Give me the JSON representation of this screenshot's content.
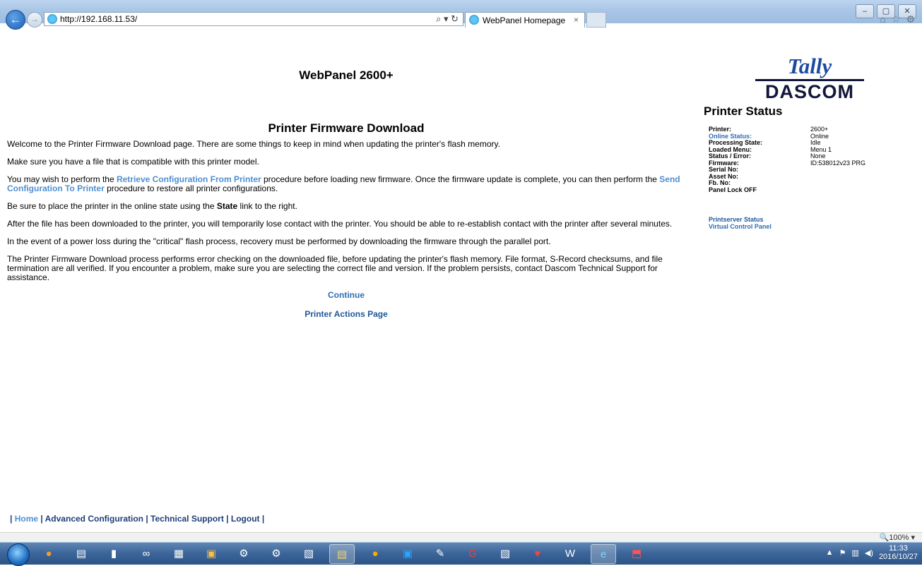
{
  "browser": {
    "title_text": "",
    "url": "http://192.168.11.53/",
    "search_glyph": "⌕ ▾ ↻",
    "tab_label": "WebPanel Homepage",
    "tab_close": "×",
    "window_controls": {
      "minimize": "–",
      "maximize": "▢",
      "close": "✕"
    },
    "zoom_label": "🔍100%  ▾"
  },
  "page": {
    "site_title": "WebPanel 2600+",
    "logo": {
      "top": "Tally",
      "bottom": "DASCOM"
    },
    "heading": "Printer Firmware Download",
    "paragraphs": {
      "p1": "Welcome to the Printer Firmware Download page. There are some things to keep in mind when updating the printer's flash memory.",
      "p2": "Make sure you have a file that is compatible with this printer model.",
      "p3_a": "You may wish to perform the ",
      "p3_link1": "Retrieve Configuration From Printer",
      "p3_b": " procedure before loading new firmware. Once the firmware update is complete, you can then perform the ",
      "p3_link2": "Send Configuration To Printer",
      "p3_c": " procedure to restore all printer configurations.",
      "p4_a": "Be sure to place the printer in the online state using the ",
      "p4_bold": "State",
      "p4_b": " link to the right.",
      "p5": "After the file has been downloaded to the printer, you will temporarily lose contact with the printer. You should be able to re-establish contact with the printer after several minutes.",
      "p6": "In the event of a power loss during the \"critical\" flash process, recovery must be performed by downloading the firmware through the parallel port.",
      "p7": "The Printer Firmware Download process performs error checking on the downloaded file, before updating the printer's flash memory. File format, S-Record checksums, and file termination are all verified. If you encounter a problem, make sure you are selecting the correct file and version. If the problem persists, contact Dascom Technical Support for assistance."
    },
    "continue_link": "Continue",
    "actions_link": "Printer Actions Page"
  },
  "status": {
    "heading": "Printer Status",
    "rows": [
      {
        "key": "Printer:",
        "value": "2600+"
      },
      {
        "key": "Online Status:",
        "value": "Online"
      },
      {
        "key": "Processing State:",
        "value": "Idle"
      },
      {
        "key": "Loaded Menu:",
        "value": "Menu 1"
      },
      {
        "key": "Status / Error:",
        "value": "None"
      },
      {
        "key": "Firmware:",
        "value": "ID:538012v23 PRG"
      },
      {
        "key": "Serial No:",
        "value": ""
      },
      {
        "key": "Asset No:",
        "value": ""
      },
      {
        "key": "Fb. No:",
        "value": ""
      },
      {
        "key": "Panel Lock OFF",
        "value": ""
      }
    ],
    "links": {
      "printserver": "Printserver Status",
      "virtual_panel": "Virtual Control Panel"
    }
  },
  "footer": {
    "sep": "|",
    "home": "Home",
    "advanced": "Advanced Configuration",
    "support": "Technical Support",
    "logout": "Logout"
  },
  "taskbar": {
    "apps": [
      "firefox-icon",
      "explorer-icon",
      "app-icon",
      "network-icon",
      "calc-icon",
      "mfc-icon",
      "gear-icon",
      "gear-icon",
      "photo-icon",
      "notes-icon",
      "qq-icon",
      "box-icon",
      "tool-icon",
      "red-g-icon",
      "fax-icon",
      "heart-icon",
      "word-icon",
      "ie-icon",
      "acrobat-icon"
    ],
    "time": "11:33",
    "date": "2016/10/27"
  },
  "colors": {
    "link": "#4f8fd1",
    "dark_link": "#1f5799",
    "logo_blue": "#1d4ba0",
    "logo_dark": "#12163a"
  }
}
